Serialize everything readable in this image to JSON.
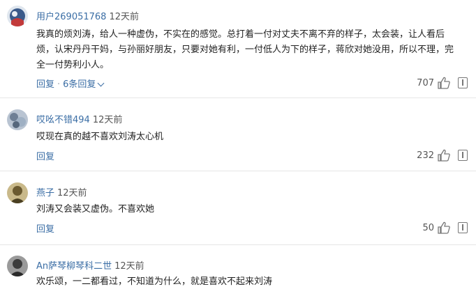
{
  "comments": [
    {
      "user": "用户269051768",
      "time": "12天前",
      "text": "我真的烦刘涛，给人一种虚伪，不实在的感觉。总打着一付对丈夫不离不弃的样子，太会装，让人看后烦，认宋丹丹干妈，与孙丽好朋友，只要对她有利，一付低人为下的样子，蒋欣对她没用，所以不理，完全一付势利小人。",
      "reply_label": "回复",
      "replies_label": "6条回复",
      "likes": "707",
      "avatar_color": "#3a5a8a"
    },
    {
      "user": "哎吆不错494",
      "time": "12天前",
      "text": "哎现在真的越不喜欢刘涛太心机",
      "reply_label": "回复",
      "likes": "232",
      "avatar_color": "#8a9bb0"
    },
    {
      "user": "燕子",
      "time": "12天前",
      "text": "刘涛又会装又虚伪。不喜欢她",
      "reply_label": "回复",
      "likes": "50",
      "avatar_color": "#8a7a4a"
    },
    {
      "user": "An萨琴柳琴科二世",
      "time": "12天前",
      "text": "欢乐颂，一二都看过，不知道为什么，就是喜欢不起来刘涛",
      "avatar_color": "#555555"
    }
  ],
  "separator": "·"
}
